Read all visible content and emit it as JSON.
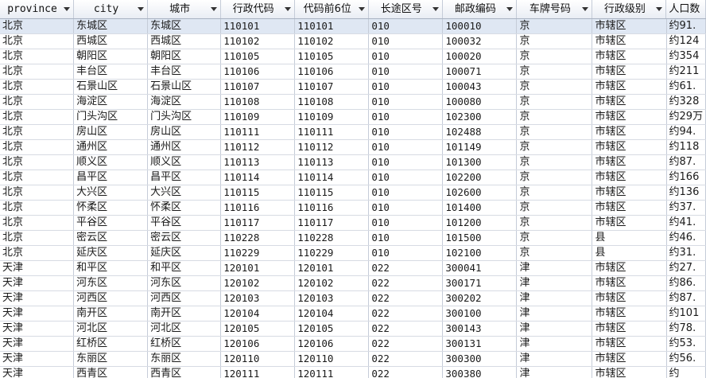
{
  "columns": [
    {
      "label": "province"
    },
    {
      "label": "city"
    },
    {
      "label": "城市"
    },
    {
      "label": "行政代码"
    },
    {
      "label": "代码前6位"
    },
    {
      "label": "长途区号"
    },
    {
      "label": "邮政编码"
    },
    {
      "label": "车牌号码"
    },
    {
      "label": "行政级别"
    },
    {
      "label": "人口数"
    }
  ],
  "rows": [
    [
      "北京",
      "东城区",
      "东城区",
      "110101",
      "110101",
      "010",
      "100010",
      "京",
      "市辖区",
      "约91."
    ],
    [
      "北京",
      "西城区",
      "西城区",
      "110102",
      "110102",
      "010",
      "100032",
      "京",
      "市辖区",
      "约124"
    ],
    [
      "北京",
      "朝阳区",
      "朝阳区",
      "110105",
      "110105",
      "010",
      "100020",
      "京",
      "市辖区",
      "约354"
    ],
    [
      "北京",
      "丰台区",
      "丰台区",
      "110106",
      "110106",
      "010",
      "100071",
      "京",
      "市辖区",
      "约211"
    ],
    [
      "北京",
      "石景山区",
      "石景山区",
      "110107",
      "110107",
      "010",
      "100043",
      "京",
      "市辖区",
      "约61."
    ],
    [
      "北京",
      "海淀区",
      "海淀区",
      "110108",
      "110108",
      "010",
      "100080",
      "京",
      "市辖区",
      "约328"
    ],
    [
      "北京",
      "门头沟区",
      "门头沟区",
      "110109",
      "110109",
      "010",
      "102300",
      "京",
      "市辖区",
      "约29万"
    ],
    [
      "北京",
      "房山区",
      "房山区",
      "110111",
      "110111",
      "010",
      "102488",
      "京",
      "市辖区",
      "约94."
    ],
    [
      "北京",
      "通州区",
      "通州区",
      "110112",
      "110112",
      "010",
      "101149",
      "京",
      "市辖区",
      "约118"
    ],
    [
      "北京",
      "顺义区",
      "顺义区",
      "110113",
      "110113",
      "010",
      "101300",
      "京",
      "市辖区",
      "约87."
    ],
    [
      "北京",
      "昌平区",
      "昌平区",
      "110114",
      "110114",
      "010",
      "102200",
      "京",
      "市辖区",
      "约166"
    ],
    [
      "北京",
      "大兴区",
      "大兴区",
      "110115",
      "110115",
      "010",
      "102600",
      "京",
      "市辖区",
      "约136"
    ],
    [
      "北京",
      "怀柔区",
      "怀柔区",
      "110116",
      "110116",
      "010",
      "101400",
      "京",
      "市辖区",
      "约37."
    ],
    [
      "北京",
      "平谷区",
      "平谷区",
      "110117",
      "110117",
      "010",
      "101200",
      "京",
      "市辖区",
      "约41."
    ],
    [
      "北京",
      "密云区",
      "密云区",
      "110228",
      "110228",
      "010",
      "101500",
      "京",
      "县",
      "约46."
    ],
    [
      "北京",
      "延庆区",
      "延庆区",
      "110229",
      "110229",
      "010",
      "102100",
      "京",
      "县",
      "约31."
    ],
    [
      "天津",
      "和平区",
      "和平区",
      "120101",
      "120101",
      "022",
      "300041",
      "津",
      "市辖区",
      "约27."
    ],
    [
      "天津",
      "河东区",
      "河东区",
      "120102",
      "120102",
      "022",
      "300171",
      "津",
      "市辖区",
      "约86."
    ],
    [
      "天津",
      "河西区",
      "河西区",
      "120103",
      "120103",
      "022",
      "300202",
      "津",
      "市辖区",
      "约87."
    ],
    [
      "天津",
      "南开区",
      "南开区",
      "120104",
      "120104",
      "022",
      "300100",
      "津",
      "市辖区",
      "约101"
    ],
    [
      "天津",
      "河北区",
      "河北区",
      "120105",
      "120105",
      "022",
      "300143",
      "津",
      "市辖区",
      "约78."
    ],
    [
      "天津",
      "红桥区",
      "红桥区",
      "120106",
      "120106",
      "022",
      "300131",
      "津",
      "市辖区",
      "约53."
    ],
    [
      "天津",
      "东丽区",
      "东丽区",
      "120110",
      "120110",
      "022",
      "300300",
      "津",
      "市辖区",
      "约56."
    ],
    [
      "天津",
      "西青区",
      "西青区",
      "120111",
      "120111",
      "022",
      "300380",
      "津",
      "市辖区",
      "约"
    ]
  ]
}
